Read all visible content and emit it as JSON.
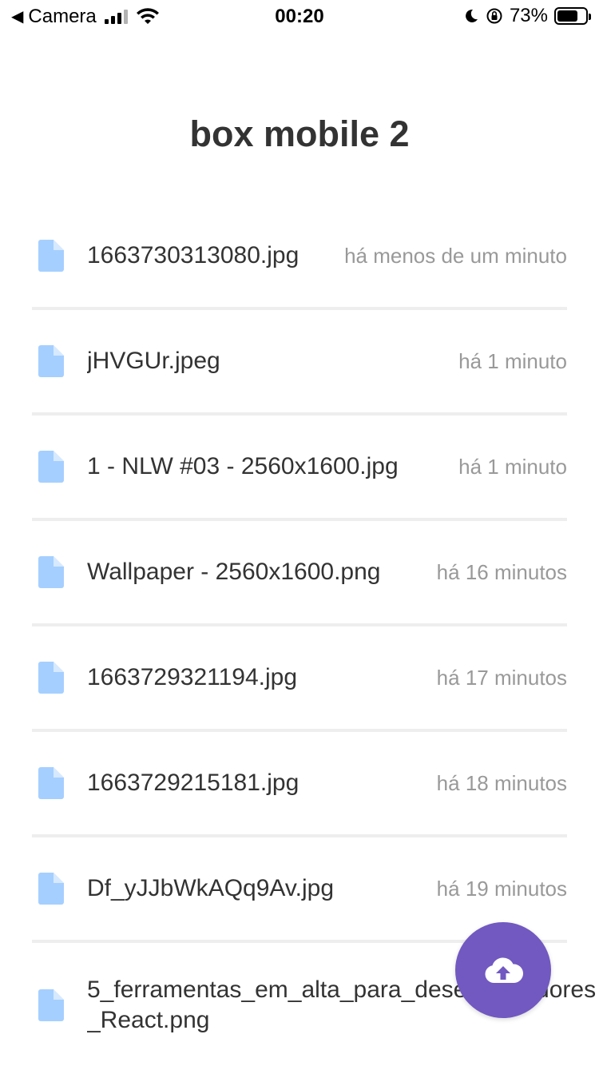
{
  "status_bar": {
    "back_label": "Camera",
    "time": "00:20",
    "battery_percent": "73%",
    "battery_level": 0.73,
    "icons": [
      "back-arrow-icon",
      "signal-icon",
      "wifi-icon",
      "moon-icon",
      "orientation-lock-icon",
      "battery-icon"
    ]
  },
  "header": {
    "title": "box mobile 2"
  },
  "files": [
    {
      "name": "1663730313080.jpg",
      "time": "há menos de um minuto"
    },
    {
      "name": "jHVGUr.jpeg",
      "time": "há 1 minuto"
    },
    {
      "name": "1 - NLW #03 - 2560x1600.jpg",
      "time": "há 1 minuto"
    },
    {
      "name": "Wallpaper - 2560x1600.png",
      "time": "há 16 minutos"
    },
    {
      "name": "1663729321194.jpg",
      "time": "há 17 minutos"
    },
    {
      "name": "1663729215181.jpg",
      "time": "há 18 minutos"
    },
    {
      "name": "Df_yJJbWkAQq9Av.jpg",
      "time": "há 19 minutos"
    },
    {
      "name": "5_ferramentas_em_alta_para_desenvolvedores_React.png",
      "time": ""
    }
  ],
  "fab": {
    "icon": "cloud-upload-icon"
  },
  "colors": {
    "accent": "#7159c1",
    "file_icon": "#a5cfff",
    "divider": "#eeeeee",
    "time_text": "#999999",
    "title_text": "#333333"
  }
}
